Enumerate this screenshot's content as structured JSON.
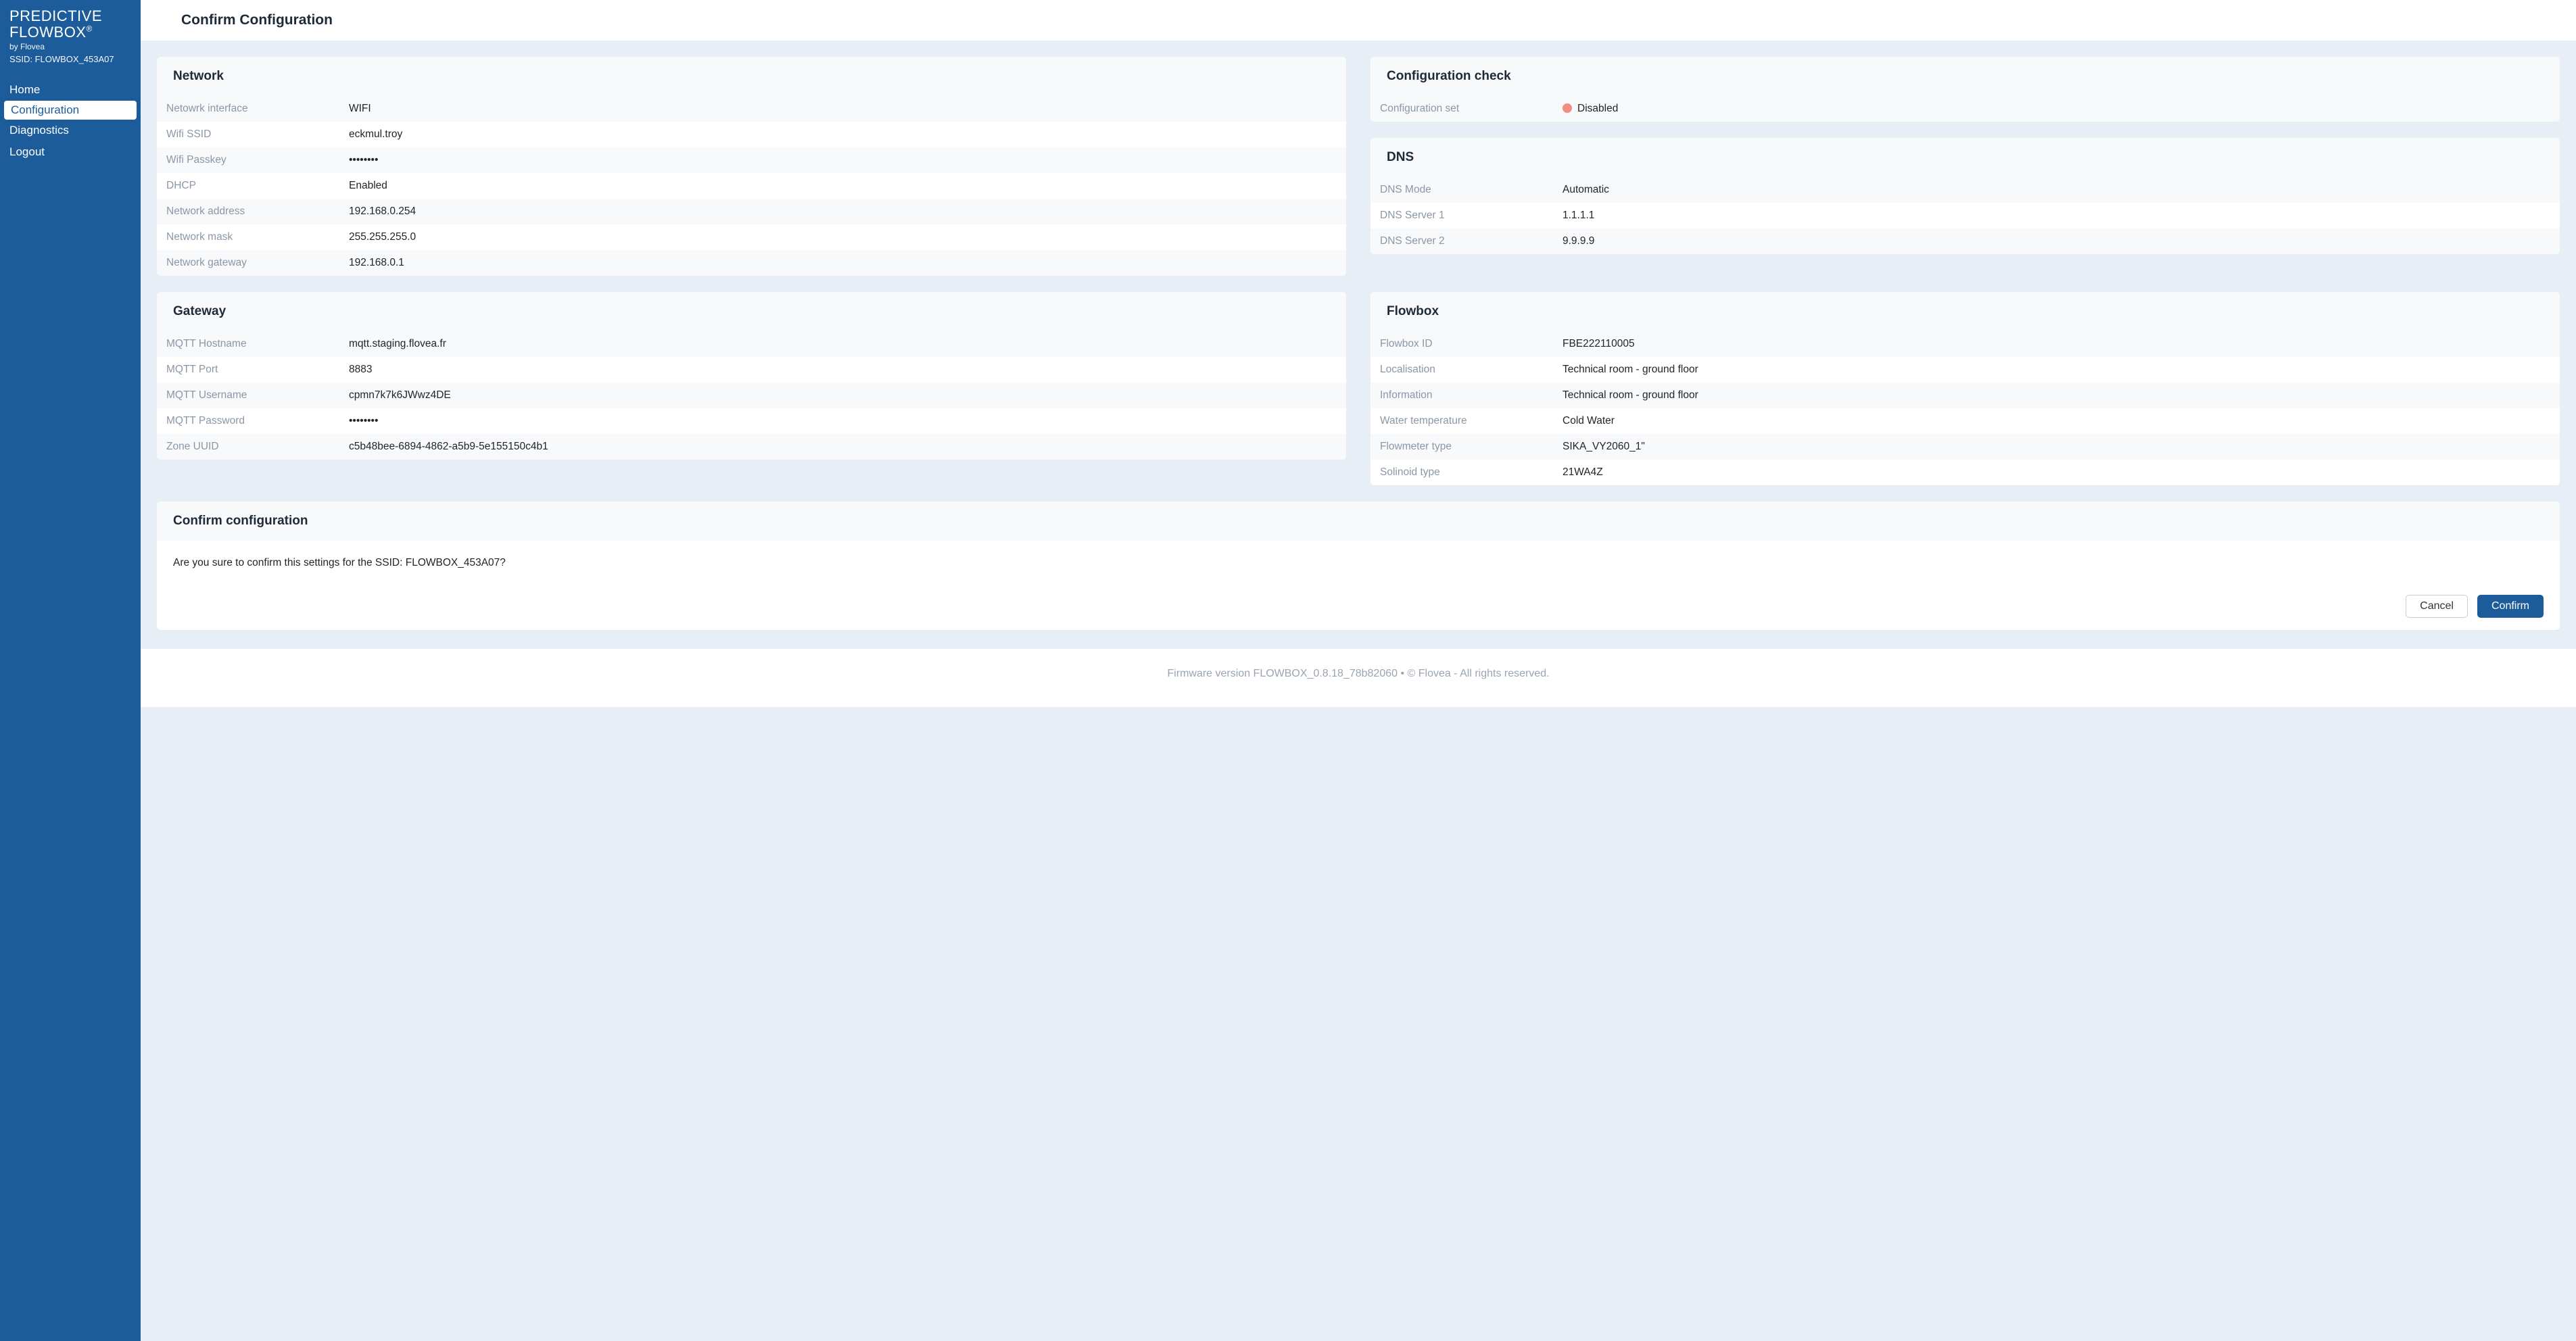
{
  "sidebar": {
    "brand_line1": "PREDICTIVE",
    "brand_line2": "FLOWBOX",
    "brand_reg": "®",
    "brand_by": "by Flovea",
    "brand_ssid": "SSID: FLOWBOX_453A07",
    "nav": [
      {
        "label": "Home"
      },
      {
        "label": "Configuration"
      },
      {
        "label": "Diagnostics"
      },
      {
        "label": "Logout"
      }
    ]
  },
  "page_title": "Confirm Configuration",
  "network": {
    "title": "Network",
    "rows": [
      {
        "label": "Netowrk interface",
        "value": "WIFI"
      },
      {
        "label": "Wifi SSID",
        "value": "eckmul.troy"
      },
      {
        "label": "Wifi Passkey",
        "value": "••••••••"
      },
      {
        "label": "DHCP",
        "value": "Enabled"
      },
      {
        "label": "Network address",
        "value": "192.168.0.254"
      },
      {
        "label": "Network mask",
        "value": "255.255.255.0"
      },
      {
        "label": "Network gateway",
        "value": "192.168.0.1"
      }
    ]
  },
  "config_check": {
    "title": "Configuration check",
    "row_label": "Configuration set",
    "row_value": "Disabled"
  },
  "dns": {
    "title": "DNS",
    "rows": [
      {
        "label": "DNS Mode",
        "value": "Automatic"
      },
      {
        "label": "DNS Server 1",
        "value": "1.1.1.1"
      },
      {
        "label": "DNS Server 2",
        "value": "9.9.9.9"
      }
    ]
  },
  "gateway": {
    "title": "Gateway",
    "rows": [
      {
        "label": "MQTT Hostname",
        "value": "mqtt.staging.flovea.fr"
      },
      {
        "label": "MQTT Port",
        "value": "8883"
      },
      {
        "label": "MQTT Username",
        "value": "cpmn7k7k6JWwz4DE"
      },
      {
        "label": "MQTT Password",
        "value": "••••••••"
      },
      {
        "label": "Zone UUID",
        "value": "c5b48bee-6894-4862-a5b9-5e155150c4b1"
      }
    ]
  },
  "flowbox": {
    "title": "Flowbox",
    "rows": [
      {
        "label": "Flowbox ID",
        "value": "FBE222110005"
      },
      {
        "label": "Localisation",
        "value": "Technical room - ground floor"
      },
      {
        "label": "Information",
        "value": "Technical room - ground floor"
      },
      {
        "label": "Water temperature",
        "value": "Cold Water"
      },
      {
        "label": "Flowmeter type",
        "value": "SIKA_VY2060_1\""
      },
      {
        "label": "Solinoid type",
        "value": "21WA4Z"
      }
    ]
  },
  "confirm": {
    "title": "Confirm configuration",
    "text": "Are you sure to confirm this settings for the SSID: FLOWBOX_453A07?",
    "cancel": "Cancel",
    "confirm": "Confirm"
  },
  "footer": "Firmware version FLOWBOX_0.8.18_78b82060 • © Flovea - All rights reserved."
}
